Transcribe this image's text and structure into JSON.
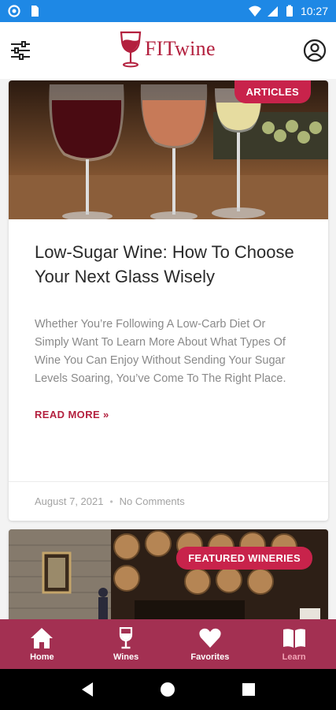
{
  "status_bar": {
    "time": "10:27"
  },
  "header": {
    "logo_text": "FITwine"
  },
  "cards": [
    {
      "badge": "ARTICLES",
      "title": "Low-Sugar Wine: How To Choose Your Next Glass Wisely",
      "excerpt": "Whether You’re Following A Low-Carb Diet Or Simply Want To Learn More About What Types Of Wine You Can Enjoy Without Sending Your Sugar Levels Soaring, You’ve Come To The Right Place.",
      "read_more": "READ MORE »",
      "date": "August 7, 2021",
      "separator": "•",
      "comments": "No Comments"
    },
    {
      "badge": "FEATURED WINERIES"
    }
  ],
  "tabs": [
    {
      "label": "Home",
      "icon": "home-icon"
    },
    {
      "label": "Wines",
      "icon": "wine-glass-icon"
    },
    {
      "label": "Favorites",
      "icon": "heart-icon"
    },
    {
      "label": "Learn",
      "icon": "book-icon",
      "active": true
    }
  ],
  "colors": {
    "status_bar": "#1e88e5",
    "brand": "#b3203e",
    "tab_bar": "#a33052",
    "badge": "#c8234b",
    "active_tab": "#f2a3b5"
  }
}
